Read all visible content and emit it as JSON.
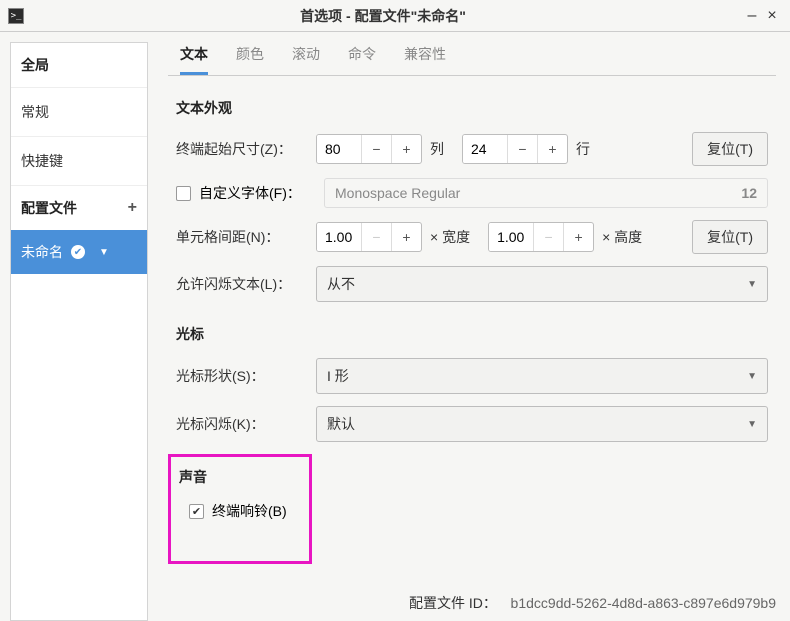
{
  "titlebar": {
    "title": "首选项 - 配置文件\"未命名\""
  },
  "sidebar": {
    "global": "全局",
    "general": "常规",
    "shortcuts": "快捷键",
    "profiles_header": "配置文件",
    "active_profile": "未命名"
  },
  "tabs": {
    "text": "文本",
    "color": "颜色",
    "scroll": "滚动",
    "command": "命令",
    "compat": "兼容性"
  },
  "sections": {
    "text_appearance": "文本外观",
    "cursor": "光标",
    "sound": "声音"
  },
  "fields": {
    "initial_size": "终端起始尺寸(Z)：",
    "cols_val": "80",
    "cols_unit": "列",
    "rows_val": "24",
    "rows_unit": "行",
    "reset": "复位(T)",
    "custom_font": "自定义字体(F)：",
    "font_name": "Monospace Regular",
    "font_size": "12",
    "cell_spacing": "单元格间距(N)：",
    "sx": "1.00",
    "width_unit": "× 宽度",
    "sy": "1.00",
    "height_unit": "× 高度",
    "blink_text": "允许闪烁文本(L)：",
    "blink_val": "从不",
    "cursor_shape": "光标形状(S)：",
    "cursor_shape_val": "I 形",
    "cursor_blink": "光标闪烁(K)：",
    "cursor_blink_val": "默认",
    "terminal_bell": "终端响铃(B)"
  },
  "footer": {
    "label": "配置文件 ID：",
    "value": "b1dcc9dd-5262-4d8d-a863-c897e6d979b9"
  }
}
